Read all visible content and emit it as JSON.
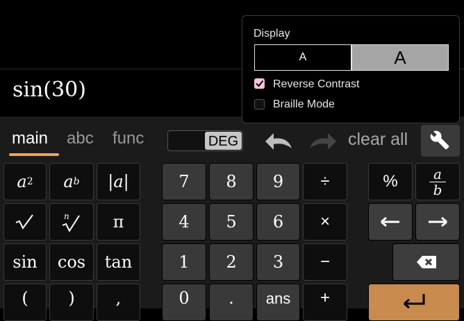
{
  "expression": {
    "text": "sin(30)"
  },
  "tabs": {
    "main": "main",
    "abc": "abc",
    "func": "func"
  },
  "angle_mode": {
    "label": "DEG"
  },
  "toolbar": {
    "clear_all": "clear all"
  },
  "display_popover": {
    "heading": "Display",
    "font_small_label": "A",
    "font_large_label": "A",
    "reverse_contrast_label": "Reverse Contrast",
    "braille_mode_label": "Braille Mode",
    "reverse_contrast_checked": true,
    "braille_mode_checked": false
  },
  "keys": {
    "abs": "|a|",
    "pi": "π",
    "sin": "sin",
    "cos": "cos",
    "tan": "tan",
    "lparen": "(",
    "rparen": ")",
    "comma": ",",
    "n7": "7",
    "n8": "8",
    "n9": "9",
    "n4": "4",
    "n5": "5",
    "n6": "6",
    "n1": "1",
    "n2": "2",
    "n3": "3",
    "n0": "0",
    "dot": ".",
    "ans": "ans",
    "divide": "÷",
    "times": "×",
    "minus": "−",
    "plus": "+",
    "percent": "%"
  },
  "colors": {
    "accent": "#f0a25a",
    "enter": "#c98a4e",
    "checkbox": "#f5c2dc"
  }
}
